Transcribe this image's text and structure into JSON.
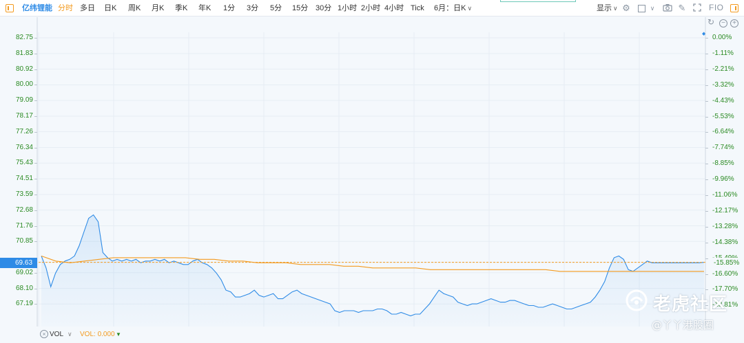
{
  "toolbar": {
    "stock_name": "亿纬锂能",
    "periods": [
      "分时",
      "多日",
      "日K",
      "周K",
      "月K",
      "季K",
      "年K",
      "1分",
      "3分",
      "5分",
      "15分",
      "30分",
      "1小时",
      "2小时",
      "4小时",
      "Tick"
    ],
    "active_period": "分时",
    "range_select": "6月：日K",
    "display_label": "显示",
    "fio_label": "FIO"
  },
  "axes": {
    "left_ticks": [
      "82.75",
      "81.83",
      "80.92",
      "80.00",
      "79.09",
      "78.17",
      "77.26",
      "76.34",
      "75.43",
      "74.51",
      "73.59",
      "72.68",
      "71.76",
      "70.85",
      "69.63",
      "69.02",
      "68.10",
      "67.19"
    ],
    "right_ticks": [
      "0.00%",
      "-1.11%",
      "-2.21%",
      "-3.32%",
      "-4.43%",
      "-5.53%",
      "-6.64%",
      "-7.74%",
      "-8.85%",
      "-9.96%",
      "-11.06%",
      "-12.17%",
      "-13.28%",
      "-14.38%",
      "-15.49%",
      "-16.60%",
      "-17.70%",
      "-18.81%"
    ],
    "current_price": "69.63",
    "current_pct": "-15.85%"
  },
  "volume": {
    "label": "VOL",
    "value": "VOL: 0.000"
  },
  "watermark": {
    "title": "老虎社区",
    "handle": "@丫丫港股圈"
  },
  "colors": {
    "price_line": "#2e8be6",
    "avg_line": "#f39a1e",
    "axis_text": "#2a8a22",
    "active": "#f39a1e"
  },
  "chart_data": {
    "type": "line",
    "ylim": [
      66.5,
      82.75
    ],
    "series": [
      {
        "values": [
          70.0,
          69.3,
          68.2,
          69.0,
          69.5,
          69.7,
          69.8,
          70.0,
          70.6,
          71.4,
          72.2,
          72.4,
          72.0,
          70.2,
          69.9,
          69.7,
          69.8,
          69.7,
          69.8,
          69.7,
          69.8,
          69.6,
          69.7,
          69.7,
          69.8,
          69.7,
          69.8,
          69.6,
          69.7,
          69.6,
          69.5,
          69.5,
          69.7,
          69.8,
          69.6,
          69.5,
          69.3,
          69.0,
          68.6,
          68.0,
          67.9,
          67.6,
          67.6,
          67.7,
          67.8,
          68.0,
          67.7,
          67.6,
          67.7,
          67.8,
          67.5,
          67.5,
          67.7,
          67.9,
          68.0,
          67.8,
          67.7,
          67.6,
          67.5,
          67.4,
          67.3,
          67.2,
          66.8,
          66.7,
          66.8,
          66.8,
          66.8,
          66.7,
          66.8,
          66.8,
          66.8,
          66.9,
          66.9,
          66.8,
          66.6,
          66.6,
          66.7,
          66.6,
          66.5,
          66.6,
          66.6,
          66.9,
          67.2,
          67.6,
          68.0,
          67.8,
          67.7,
          67.6,
          67.3,
          67.2,
          67.1,
          67.2,
          67.2,
          67.3,
          67.4,
          67.5,
          67.4,
          67.3,
          67.3,
          67.4,
          67.4,
          67.3,
          67.2,
          67.1,
          67.1,
          67.0,
          67.0,
          67.1,
          67.2,
          67.1,
          67.0,
          66.9,
          66.9,
          67.0,
          67.1,
          67.2,
          67.3,
          67.6,
          68.0,
          68.5,
          69.3,
          69.9,
          70.0,
          69.8,
          69.2,
          69.1,
          69.3,
          69.5,
          69.7,
          69.6,
          69.6,
          69.6,
          69.6,
          69.6,
          69.6,
          69.6,
          69.6,
          69.6,
          69.6,
          69.6,
          69.63
        ]
      },
      {
        "values": [
          70.0,
          69.7,
          69.6,
          69.7,
          69.8,
          69.9,
          69.9,
          69.9,
          69.9,
          69.9,
          69.9,
          69.8,
          69.8,
          69.7,
          69.7,
          69.6,
          69.6,
          69.6,
          69.5,
          69.5,
          69.5,
          69.4,
          69.4,
          69.3,
          69.3,
          69.3,
          69.3,
          69.2,
          69.2,
          69.2,
          69.2,
          69.2,
          69.2,
          69.2,
          69.2,
          69.2,
          69.1,
          69.1,
          69.1,
          69.1,
          69.1,
          69.1,
          69.1,
          69.1,
          69.1,
          69.1,
          69.1
        ]
      }
    ],
    "prev_close_pct_ref": "0.00%"
  }
}
